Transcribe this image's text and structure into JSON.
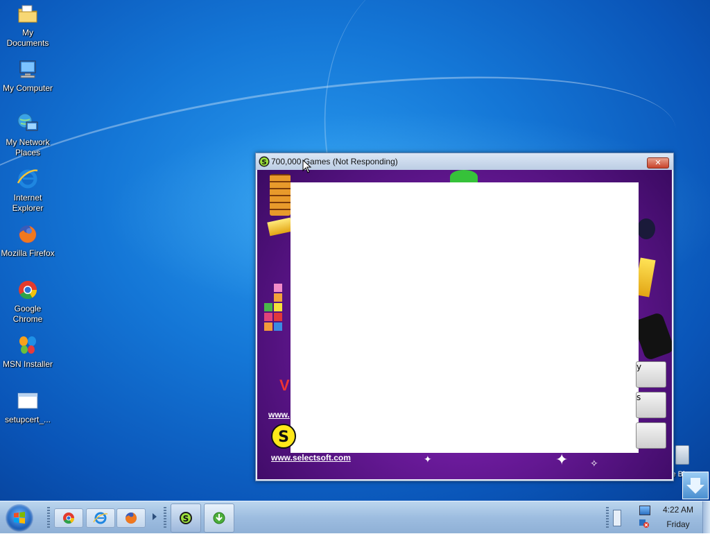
{
  "desktop": {
    "icons": [
      {
        "label": "My Documents",
        "icon": "folder-documents-icon"
      },
      {
        "label": "My Computer",
        "icon": "computer-icon"
      },
      {
        "label": "My Network Places",
        "icon": "network-places-icon"
      },
      {
        "label": "Internet Explorer",
        "icon": "internet-explorer-icon"
      },
      {
        "label": "Mozilla Firefox",
        "icon": "firefox-icon"
      },
      {
        "label": "Google Chrome",
        "icon": "chrome-icon"
      },
      {
        "label": "MSN Installer",
        "icon": "msn-butterfly-icon"
      },
      {
        "label": "setupcert_...",
        "icon": "window-app-icon"
      }
    ]
  },
  "window": {
    "title": "700,000 Games (Not Responding)",
    "close_label": "✕",
    "urls": [
      "www.",
      "www.selectsoft.com"
    ],
    "side_button_labels": [
      "y",
      "s",
      ""
    ],
    "ghost_text": "V"
  },
  "recycle_bin": {
    "label": "le Bin"
  },
  "taskbar": {
    "clock_time": "4:22 AM",
    "clock_day": "Friday",
    "quick_launch": [
      "chrome-icon",
      "internet-explorer-icon",
      "firefox-icon"
    ],
    "tasks": [
      "selectsoft-games-icon",
      "download-installer-icon"
    ]
  },
  "colors": {
    "accent_title": "#bccde4",
    "close_red": "#c8432b",
    "content_purple": "#6a1a9a"
  }
}
